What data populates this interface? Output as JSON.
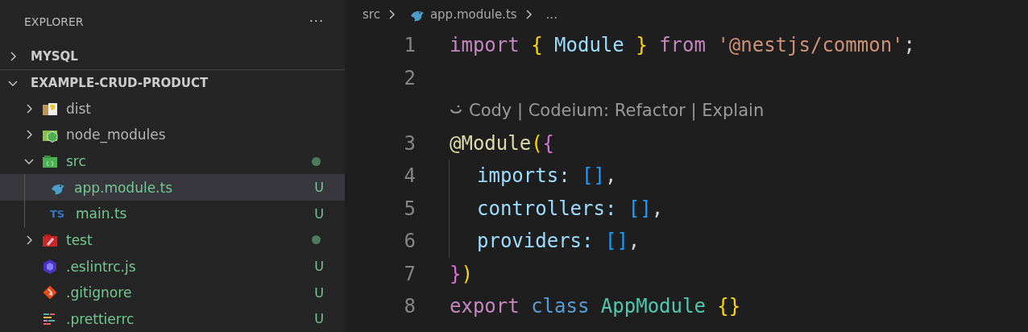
{
  "sidebar": {
    "title": "EXPLORER",
    "more": "···",
    "sections": [
      {
        "title": "MYSQL",
        "expanded": false
      },
      {
        "title": "EXAMPLE-CRUD-PRODUCT",
        "expanded": true,
        "items": [
          {
            "name": "dist",
            "kind": "folder",
            "expanded": false,
            "selected": false
          },
          {
            "name": "node_modules",
            "kind": "folder",
            "expanded": false,
            "selected": false
          },
          {
            "name": "src",
            "kind": "folder",
            "expanded": true,
            "selected": false,
            "status": {
              "kind": "dot"
            },
            "children": [
              {
                "name": "app.module.ts",
                "kind": "file",
                "selected": true,
                "status": {
                  "kind": "letter",
                  "text": "U"
                }
              },
              {
                "name": "main.ts",
                "kind": "file",
                "badge": "TS",
                "selected": false,
                "status": {
                  "kind": "letter",
                  "text": "U"
                }
              }
            ]
          },
          {
            "name": "test",
            "kind": "folder",
            "expanded": false,
            "selected": false,
            "status": {
              "kind": "dot"
            }
          },
          {
            "name": ".eslintrc.js",
            "kind": "file",
            "selected": false,
            "status": {
              "kind": "letter",
              "text": "U"
            }
          },
          {
            "name": ".gitignore",
            "kind": "file",
            "selected": false,
            "status": {
              "kind": "letter",
              "text": "U"
            }
          },
          {
            "name": ".prettierrc",
            "kind": "file",
            "selected": false,
            "status": {
              "kind": "letter",
              "text": "U"
            }
          }
        ]
      }
    ]
  },
  "breadcrumbs": {
    "folder": "src",
    "file": "app.module.ts",
    "more": "..."
  },
  "editor": {
    "lines": [
      {
        "kind": "code",
        "number": "1",
        "tokens": [
          {
            "text": "import ",
            "kind": "keyword"
          },
          {
            "text": "{ ",
            "kind": "brace1"
          },
          {
            "text": "Module ",
            "kind": "variable"
          },
          {
            "text": "} ",
            "kind": "brace1"
          },
          {
            "text": "from ",
            "kind": "keyword"
          },
          {
            "text": "'@nestjs/common'",
            "kind": "string"
          },
          {
            "text": ";",
            "kind": "punct"
          }
        ]
      },
      {
        "kind": "code",
        "number": "2"
      },
      {
        "kind": "codelens",
        "text": "Cody | Codeium: Refactor | Explain"
      },
      {
        "kind": "code",
        "number": "3",
        "tokens": [
          {
            "text": "@Module",
            "kind": "decorator"
          },
          {
            "text": "(",
            "kind": "brace1"
          },
          {
            "text": "{",
            "kind": "brace2"
          }
        ]
      },
      {
        "kind": "code",
        "number": "4",
        "indent": true,
        "tokens": [
          {
            "text": "imports: ",
            "kind": "variable"
          },
          {
            "text": "[]",
            "kind": "brace3"
          },
          {
            "text": ",",
            "kind": "punct"
          }
        ]
      },
      {
        "kind": "code",
        "number": "5",
        "indent": true,
        "tokens": [
          {
            "text": "controllers: ",
            "kind": "variable"
          },
          {
            "text": "[]",
            "kind": "brace3"
          },
          {
            "text": ",",
            "kind": "punct"
          }
        ]
      },
      {
        "kind": "code",
        "number": "6",
        "indent": true,
        "tokens": [
          {
            "text": "providers: ",
            "kind": "variable"
          },
          {
            "text": "[]",
            "kind": "brace3"
          },
          {
            "text": ",",
            "kind": "punct"
          }
        ]
      },
      {
        "kind": "code",
        "number": "7",
        "tokens": [
          {
            "text": "}",
            "kind": "brace2"
          },
          {
            "text": ")",
            "kind": "brace1"
          }
        ]
      },
      {
        "kind": "code",
        "number": "8",
        "tokens": [
          {
            "text": "export ",
            "kind": "keyword"
          },
          {
            "text": "class ",
            "kind": "storage"
          },
          {
            "text": "AppModule ",
            "kind": "class"
          },
          {
            "text": "{}",
            "kind": "brace1"
          }
        ]
      }
    ]
  }
}
